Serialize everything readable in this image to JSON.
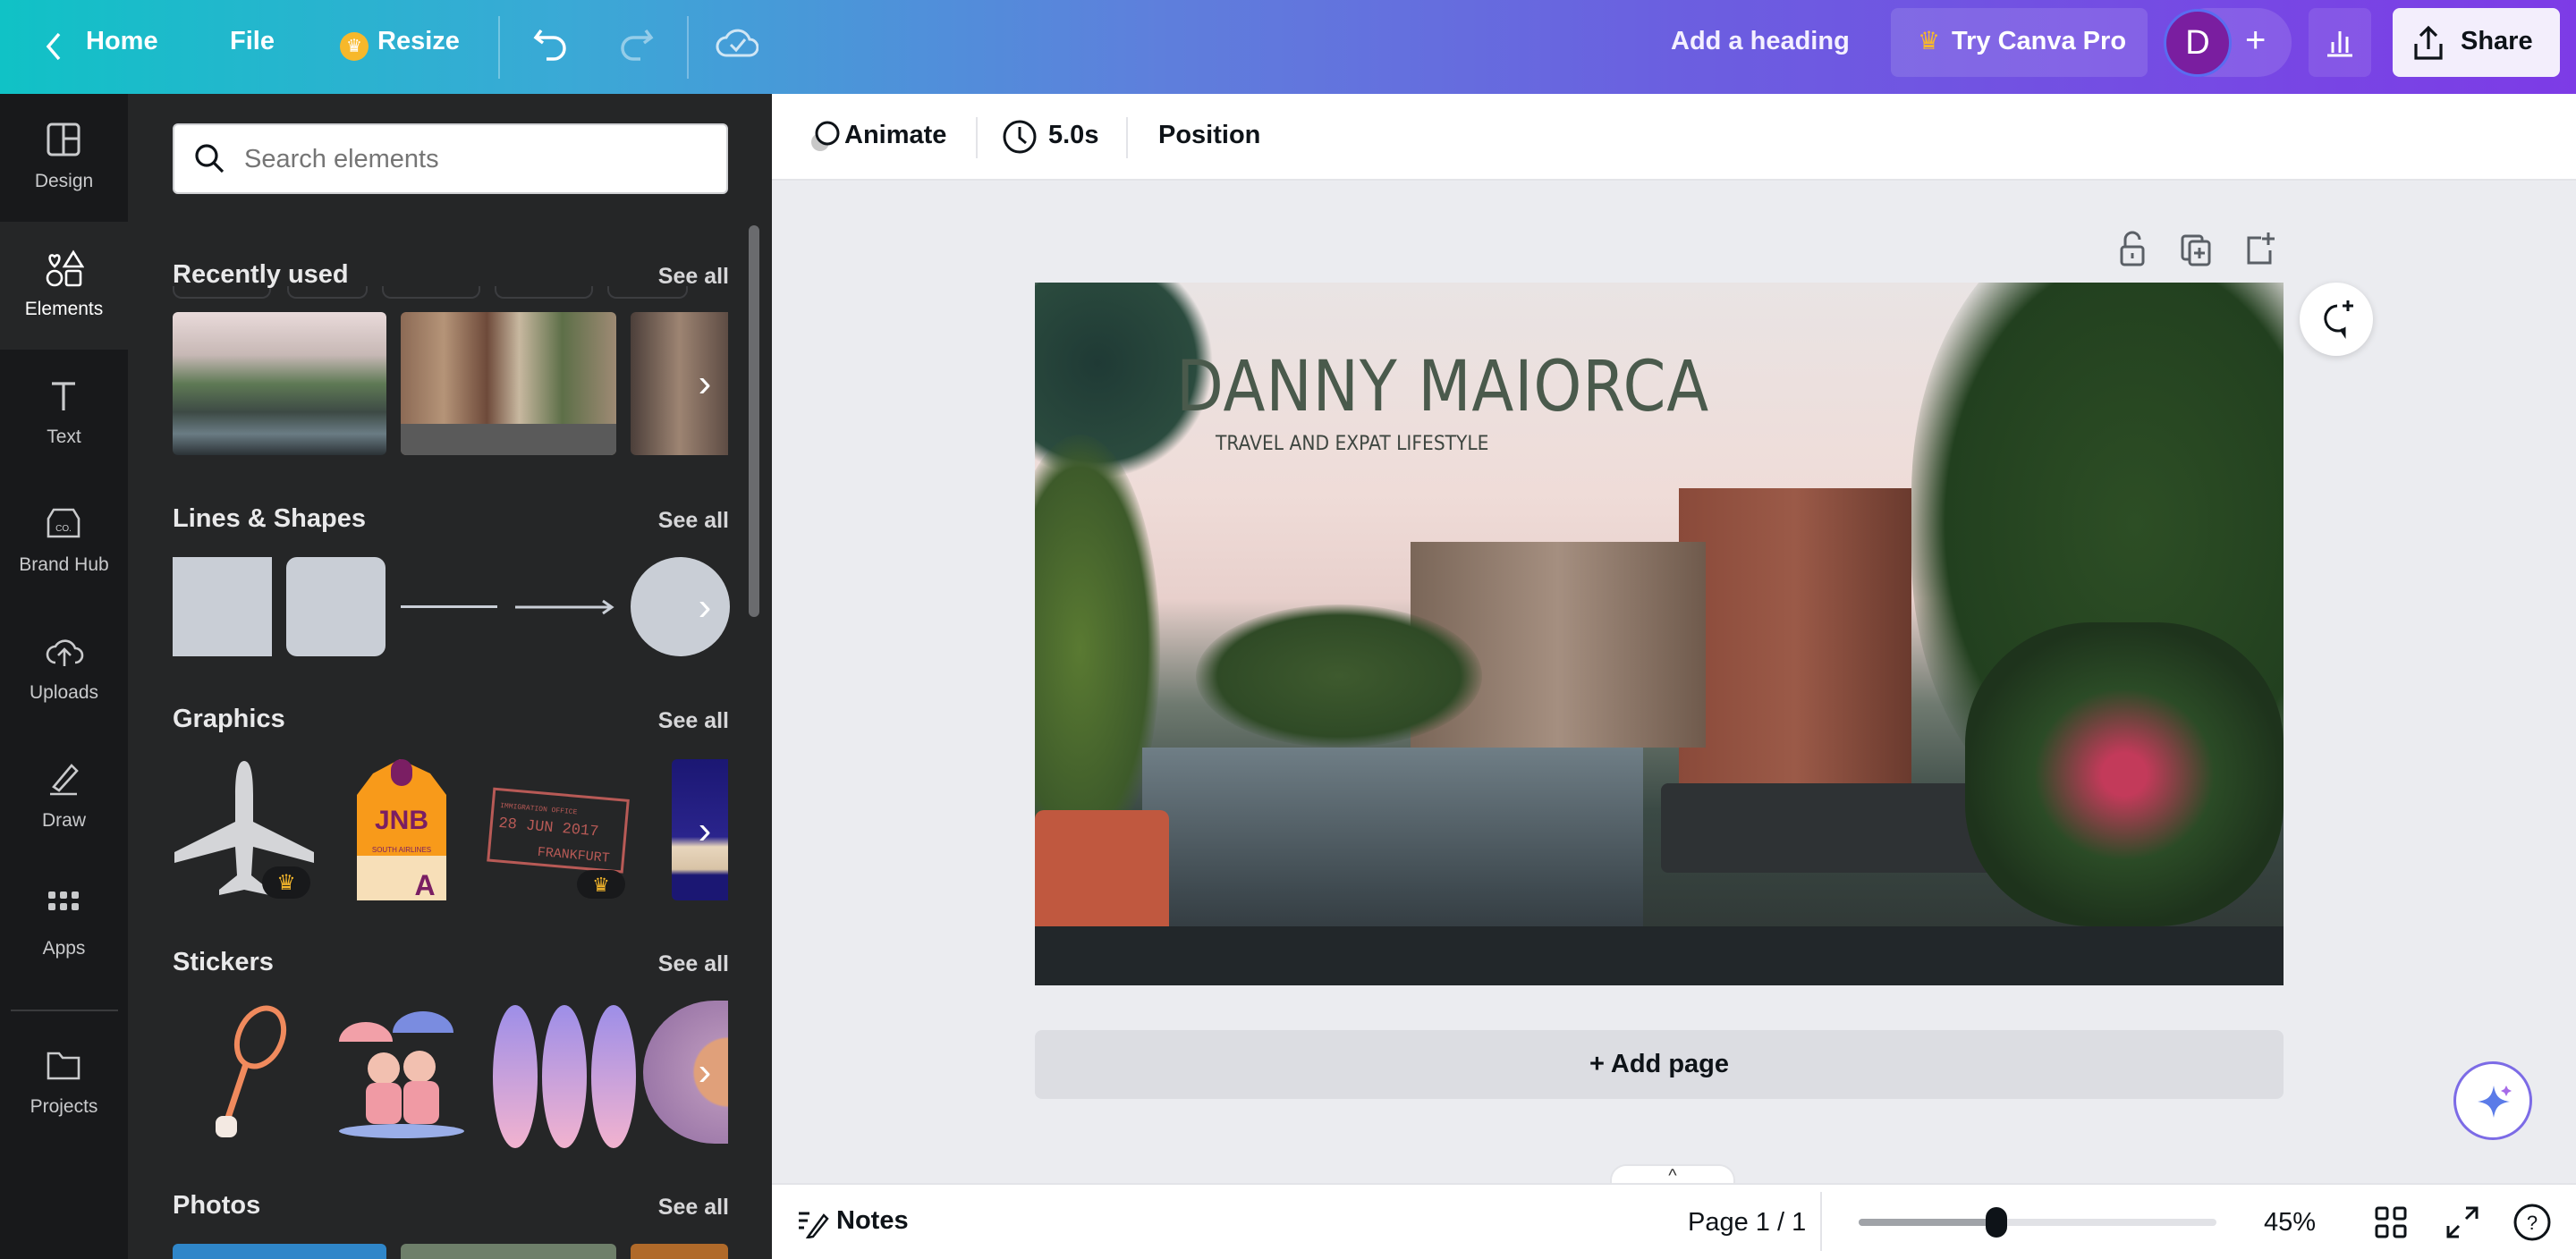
{
  "topbar": {
    "home": "Home",
    "file": "File",
    "resize": "Resize",
    "design_title": "Add a heading",
    "try_pro": "Try Canva Pro",
    "avatar_initial": "D",
    "add_collaborator": "+",
    "share": "Share"
  },
  "rail": [
    {
      "label": "Design"
    },
    {
      "label": "Elements"
    },
    {
      "label": "Text"
    },
    {
      "label": "Brand Hub"
    },
    {
      "label": "Uploads"
    },
    {
      "label": "Draw"
    },
    {
      "label": "Apps"
    },
    {
      "label": "Projects"
    }
  ],
  "panel": {
    "search_placeholder": "Search elements",
    "see_all": "See all",
    "sections": {
      "recent": "Recently used",
      "shapes": "Lines & Shapes",
      "graphics": "Graphics",
      "stickers": "Stickers",
      "photos": "Photos"
    }
  },
  "toolbar": {
    "animate": "Animate",
    "duration": "5.0s",
    "position": "Position"
  },
  "design": {
    "heading": "DANNY MAIORCA",
    "subheading": "TRAVEL AND EXPAT LIFESTYLE"
  },
  "canvas": {
    "add_page": "+ Add page"
  },
  "bottombar": {
    "notes": "Notes",
    "page_indicator": "Page 1 / 1",
    "zoom_label": "45%",
    "zoom_slider_fraction": 0.385
  },
  "colors": {
    "accent_purple": "#7d2ae8",
    "heading_green": "#4a5a4c",
    "crown": "#f7b82b"
  }
}
